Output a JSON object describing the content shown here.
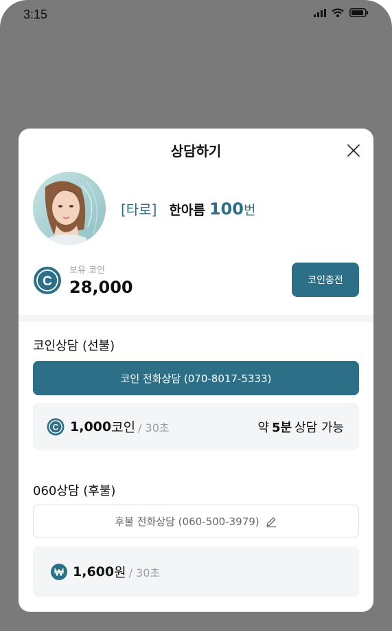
{
  "status_bar": {
    "time": "3:15"
  },
  "modal": {
    "title": "상담하기",
    "counselor": {
      "category": "[타로]",
      "name": "한아름",
      "number": "100",
      "number_suffix": "번"
    },
    "coins": {
      "label": "보유 코인",
      "value": "28,000",
      "charge_button": "코인충전"
    },
    "prepaid": {
      "title": "코인상담 (선불)",
      "call_button": "코인 전화상담 (070-8017-5333)",
      "price": {
        "amount": "1,000",
        "unit": "코인",
        "per": "/ 30초"
      },
      "available": {
        "prefix": "약",
        "duration": "5분",
        "suffix": "상담 가능"
      }
    },
    "postpaid": {
      "title": "060상담 (후불)",
      "call_button": "후불 전화상담 (060-500-3979)",
      "price": {
        "amount": "1,600",
        "unit": "원",
        "per": "/ 30초"
      }
    }
  },
  "icons": {
    "close": "close-icon",
    "coin": "coin-icon",
    "won": "won-icon",
    "edit": "pencil-icon",
    "signal": "signal-icon",
    "wifi": "wifi-icon",
    "battery": "battery-icon"
  },
  "colors": {
    "accent": "#2d6f86",
    "overlay": "#7a7a7a",
    "card_bg": "#f3f5f7"
  }
}
